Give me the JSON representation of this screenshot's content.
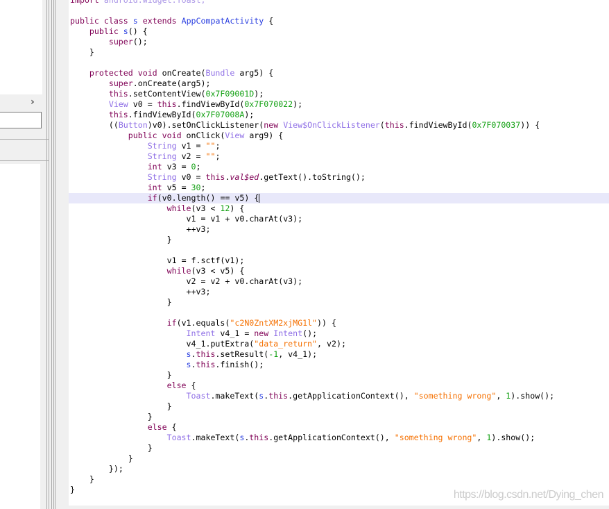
{
  "sidebar": {
    "expand_icon": "chevron-right-icon"
  },
  "editor": {
    "highlighted_line": 19,
    "lines": [
      "import android.widget.Toast;",
      "",
      "public class s extends AppCompatActivity {",
      "    public s() {",
      "        super();",
      "    }",
      "",
      "    protected void onCreate(Bundle arg5) {",
      "        super.onCreate(arg5);",
      "        this.setContentView(0x7F09001D);",
      "        View v0 = this.findViewById(0x7F070022);",
      "        this.findViewById(0x7F07008A);",
      "        ((Button)v0).setOnClickListener(new View$OnClickListener(this.findViewById(0x7F070037)) {",
      "            public void onClick(View arg9) {",
      "                String v1 = \"\";",
      "                String v2 = \"\";",
      "                int v3 = 0;",
      "                String v0 = this.val$ed.getText().toString();",
      "                int v5 = 30;",
      "                if(v0.length() == v5) {",
      "                    while(v3 < 12) {",
      "                        v1 = v1 + v0.charAt(v3);",
      "                        ++v3;",
      "                    }",
      "",
      "                    v1 = f.sctf(v1);",
      "                    while(v3 < v5) {",
      "                        v2 = v2 + v0.charAt(v3);",
      "                        ++v3;",
      "                    }",
      "",
      "                    if(v1.equals(\"c2N0ZntXM2xjMG1l\")) {",
      "                        Intent v4_1 = new Intent();",
      "                        v4_1.putExtra(\"data_return\", v2);",
      "                        s.this.setResult(-1, v4_1);",
      "                        s.this.finish();",
      "                    }",
      "                    else {",
      "                        Toast.makeText(s.this.getApplicationContext(), \"something wrong\", 1).show();",
      "                    }",
      "                }",
      "                else {",
      "                    Toast.makeText(s.this.getApplicationContext(), \"something wrong\", 1).show();",
      "                }",
      "            }",
      "        });",
      "    }",
      "}"
    ],
    "colors": {
      "keyword": "#7f0055",
      "type": "#8f6fe6",
      "class": "#2a3fe0",
      "string": "#f57000",
      "number": "#12a012",
      "highlight": "#e8e8fa"
    }
  },
  "watermark": "https://blog.csdn.net/Dying_chen"
}
